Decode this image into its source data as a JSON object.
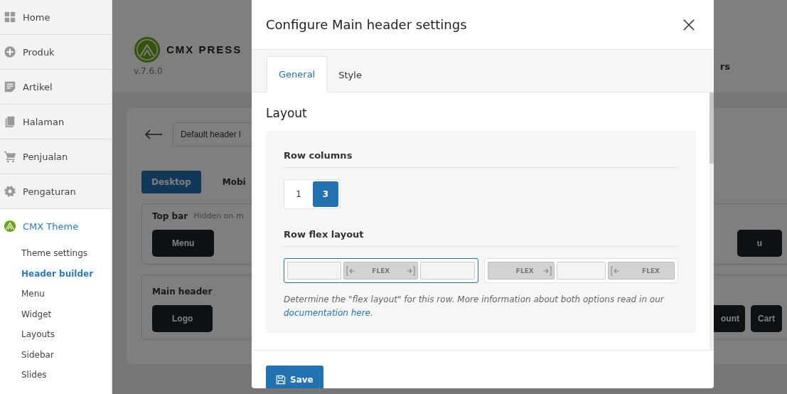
{
  "sidebar": {
    "items": [
      {
        "label": "Home",
        "selected": false
      },
      {
        "label": "Produk",
        "selected": false
      },
      {
        "label": "Artikel",
        "selected": false
      },
      {
        "label": "Halaman",
        "selected": false
      },
      {
        "label": "Penjualan",
        "selected": false
      },
      {
        "label": "Pengaturan",
        "selected": false
      },
      {
        "label": "CMX Theme",
        "selected": true,
        "children": [
          {
            "label": "Theme settings",
            "selected": false
          },
          {
            "label": "Header builder",
            "selected": true
          },
          {
            "label": "Menu",
            "selected": false
          },
          {
            "label": "Widget",
            "selected": false
          },
          {
            "label": "Layouts",
            "selected": false
          },
          {
            "label": "Sidebar",
            "selected": false
          },
          {
            "label": "Slides",
            "selected": false
          }
        ]
      }
    ]
  },
  "background": {
    "brand": "CMX PRESS",
    "version": "v.7.6.0",
    "nav_fragment": "rs",
    "header_select": "Default header l",
    "device_tabs": [
      {
        "label": "Desktop",
        "selected": true
      },
      {
        "label": "Mobi",
        "selected": false
      }
    ],
    "top_bar": {
      "title": "Top bar",
      "hint": "Hidden on m",
      "buttons": [
        "Menu"
      ],
      "right_button": "u"
    },
    "main_header": {
      "title": "Main header",
      "buttons": [
        "Logo"
      ],
      "right_buttons": [
        "ount",
        "Cart"
      ]
    }
  },
  "modal": {
    "title": "Configure Main header settings",
    "tabs": [
      {
        "label": "General",
        "selected": true
      },
      {
        "label": "Style",
        "selected": false
      }
    ],
    "section": "Layout",
    "row_columns": {
      "label": "Row columns",
      "options": [
        {
          "label": "1",
          "selected": false
        },
        {
          "label": "3",
          "selected": true
        }
      ]
    },
    "row_flex": {
      "label": "Row flex layout",
      "options": [
        {
          "selected": true,
          "cells": [
            {
              "kind": "empty"
            },
            {
              "kind": "both",
              "label": "FLEX"
            },
            {
              "kind": "empty"
            }
          ]
        },
        {
          "selected": false,
          "cells": [
            {
              "kind": "right",
              "label": "FLEX"
            },
            {
              "kind": "empty"
            },
            {
              "kind": "left",
              "label": "FLEX"
            }
          ]
        }
      ]
    },
    "help": "Determine the \"flex layout\" for this row. More information about both options read in our",
    "help_link": "documentation here",
    "help_end": ".",
    "save": "Save"
  }
}
